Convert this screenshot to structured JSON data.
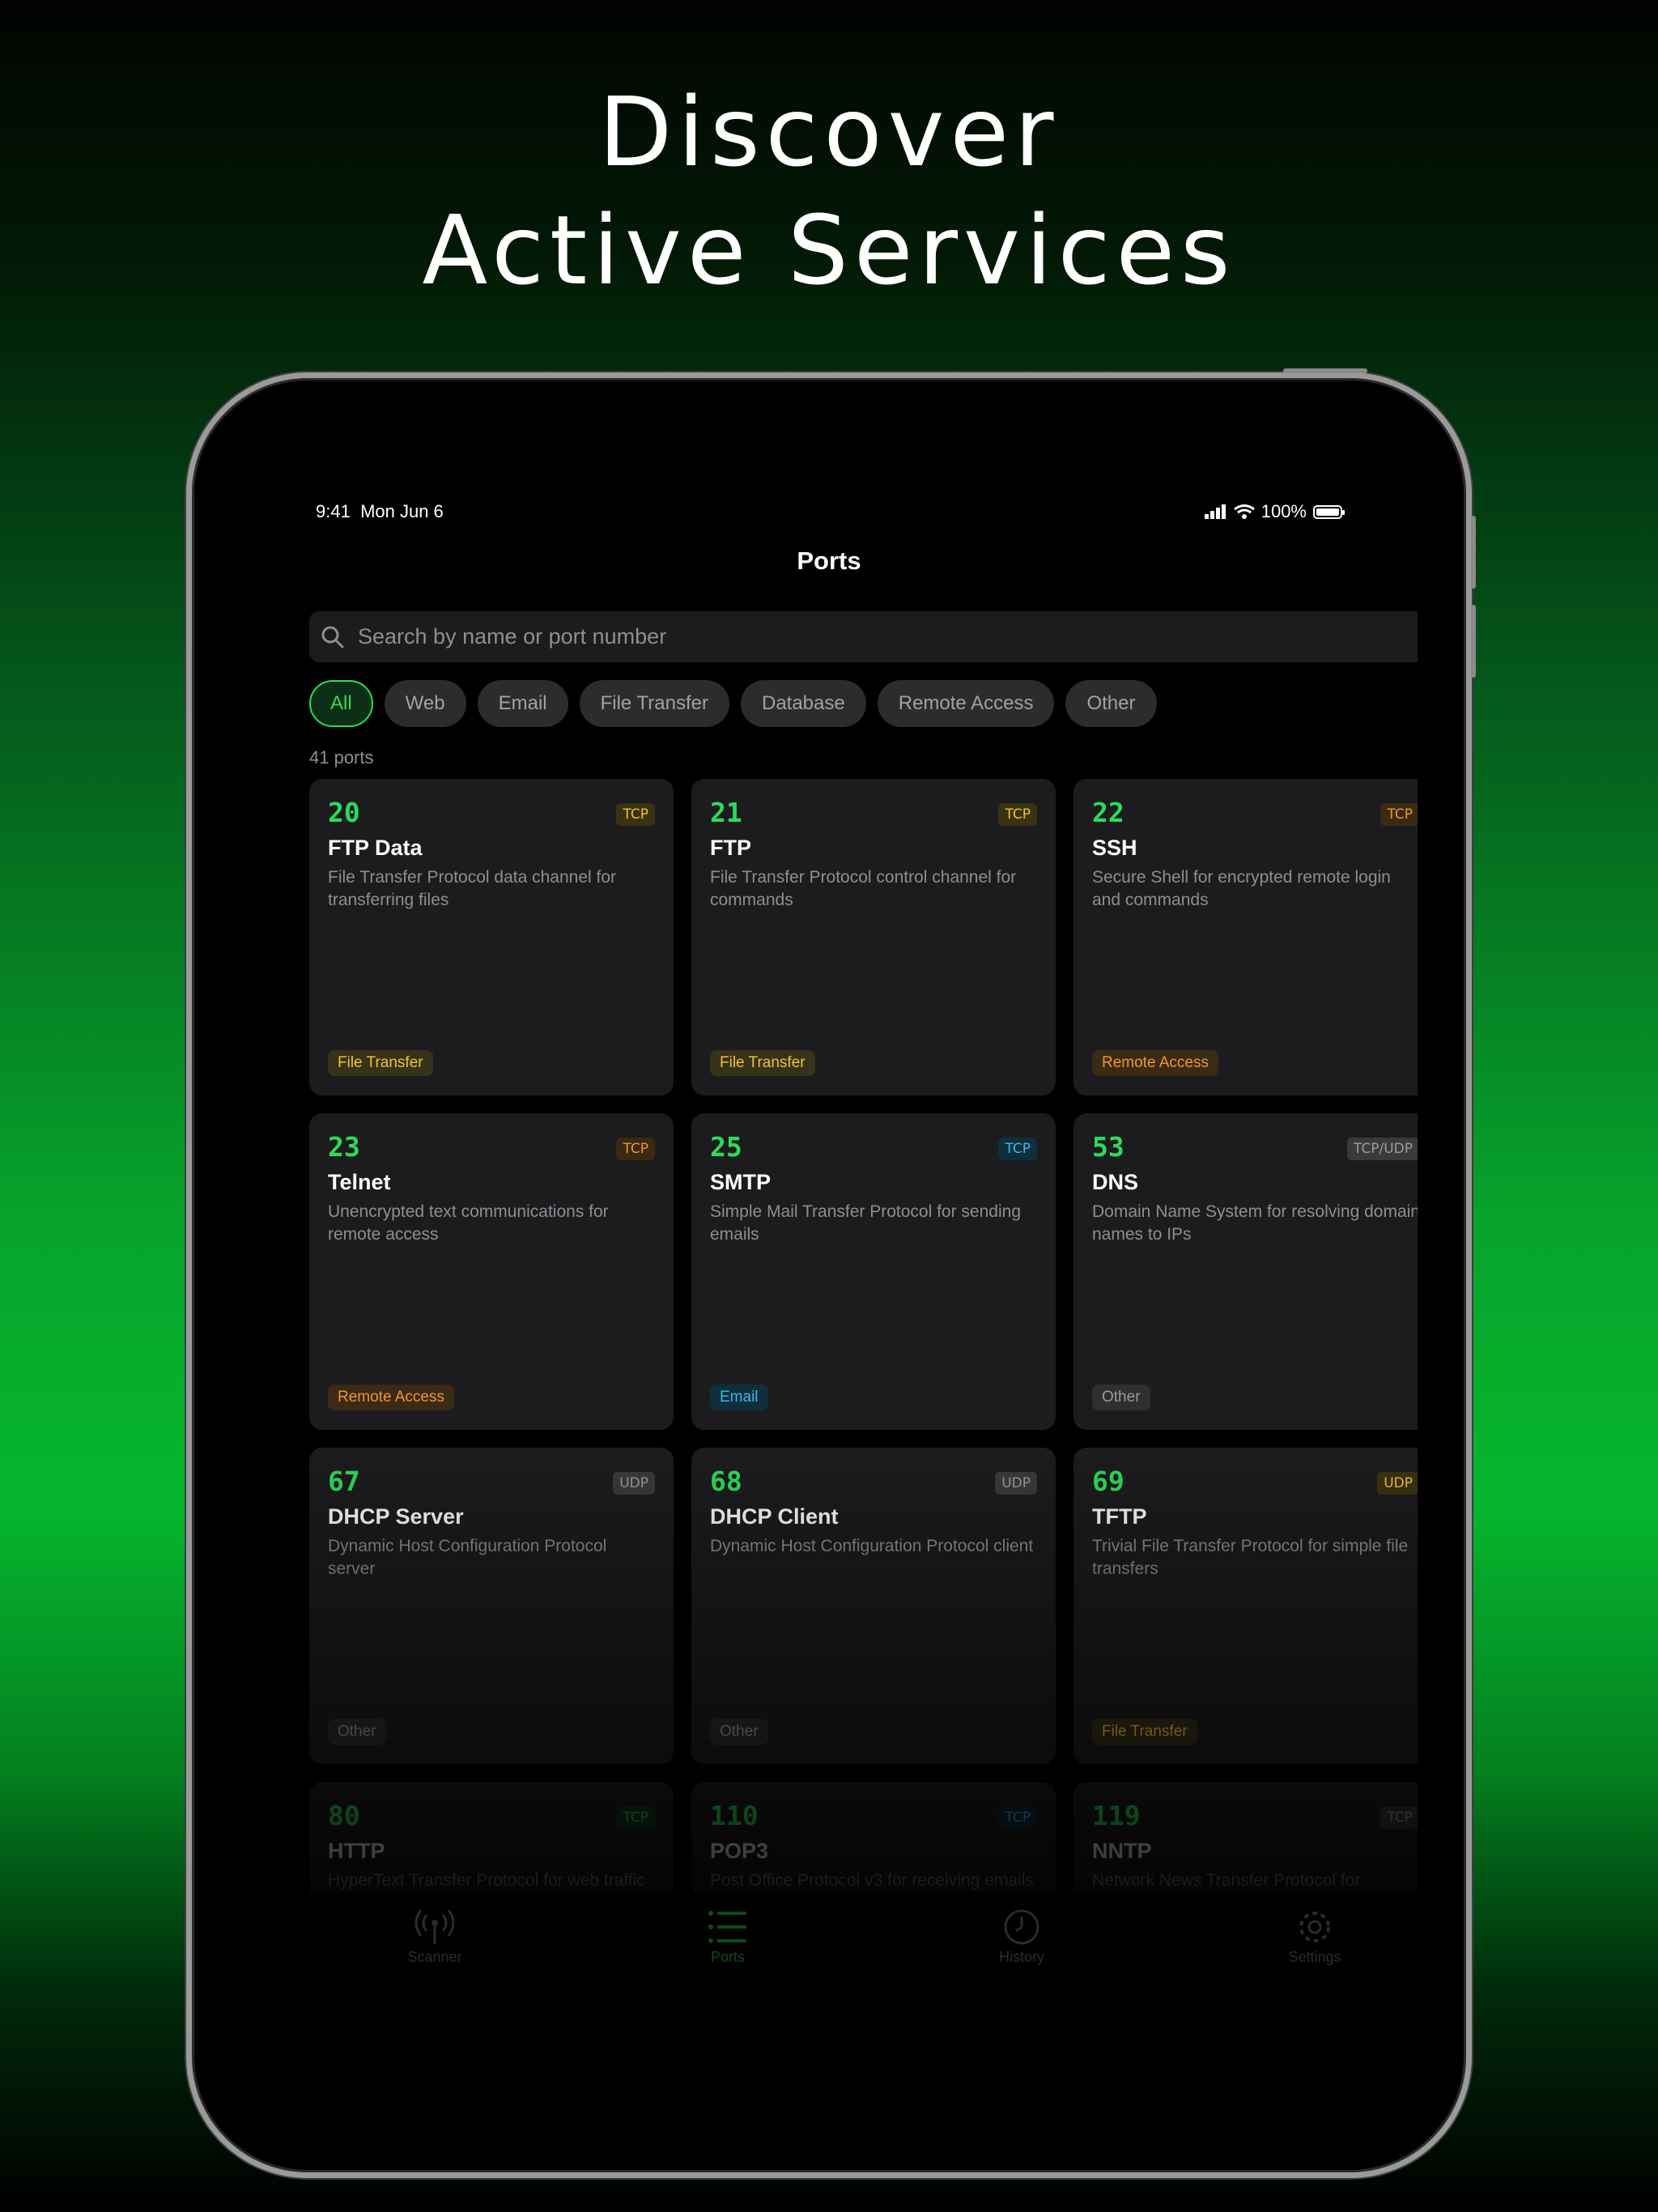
{
  "headline": {
    "line1": "Discover",
    "line2": "Active Services"
  },
  "status_bar": {
    "time": "9:41",
    "date": "Mon Jun 6",
    "battery": "100%"
  },
  "nav": {
    "title": "Ports"
  },
  "search": {
    "placeholder": "Search by name or port number"
  },
  "filters": [
    {
      "label": "All",
      "active": true
    },
    {
      "label": "Web",
      "active": false
    },
    {
      "label": "Email",
      "active": false
    },
    {
      "label": "File Transfer",
      "active": false
    },
    {
      "label": "Database",
      "active": false
    },
    {
      "label": "Remote Access",
      "active": false
    },
    {
      "label": "Other",
      "active": false
    }
  ],
  "count_label": "41 ports",
  "ports": [
    {
      "port": "20",
      "protocol": "TCP",
      "name": "FTP Data",
      "description": "File Transfer Protocol data channel for transferring files",
      "category": "File Transfer"
    },
    {
      "port": "21",
      "protocol": "TCP",
      "name": "FTP",
      "description": "File Transfer Protocol control channel for commands",
      "category": "File Transfer"
    },
    {
      "port": "22",
      "protocol": "TCP",
      "name": "SSH",
      "description": "Secure Shell for encrypted remote login and commands",
      "category": "Remote Access"
    },
    {
      "port": "23",
      "protocol": "TCP",
      "name": "Telnet",
      "description": "Unencrypted text communications for remote access",
      "category": "Remote Access"
    },
    {
      "port": "25",
      "protocol": "TCP",
      "name": "SMTP",
      "description": "Simple Mail Transfer Protocol for sending emails",
      "category": "Email"
    },
    {
      "port": "53",
      "protocol": "TCP/UDP",
      "name": "DNS",
      "description": "Domain Name System for resolving domain names to IPs",
      "category": "Other"
    },
    {
      "port": "67",
      "protocol": "UDP",
      "name": "DHCP Server",
      "description": "Dynamic Host Configuration Protocol server",
      "category": "Other"
    },
    {
      "port": "68",
      "protocol": "UDP",
      "name": "DHCP Client",
      "description": "Dynamic Host Configuration Protocol client",
      "category": "Other"
    },
    {
      "port": "69",
      "protocol": "UDP",
      "name": "TFTP",
      "description": "Trivial File Transfer Protocol for simple file transfers",
      "category": "File Transfer"
    },
    {
      "port": "80",
      "protocol": "TCP",
      "name": "HTTP",
      "description": "HyperText Transfer Protocol for web traffic",
      "category": ""
    },
    {
      "port": "110",
      "protocol": "TCP",
      "name": "POP3",
      "description": "Post Office Protocol v3 for receiving emails",
      "category": ""
    },
    {
      "port": "119",
      "protocol": "TCP",
      "name": "NNTP",
      "description": "Network News Transfer Protocol for newsgroups",
      "category": ""
    }
  ],
  "tabs": [
    {
      "label": "Scanner",
      "icon": "antenna-icon",
      "active": false
    },
    {
      "label": "Ports",
      "icon": "list-icon",
      "active": true
    },
    {
      "label": "History",
      "icon": "clock-icon",
      "active": false
    },
    {
      "label": "Settings",
      "icon": "gear-icon",
      "active": false
    }
  ],
  "colors": {
    "accent": "#2bdc5a",
    "card": "#1c1c1e",
    "background": "#000000"
  }
}
